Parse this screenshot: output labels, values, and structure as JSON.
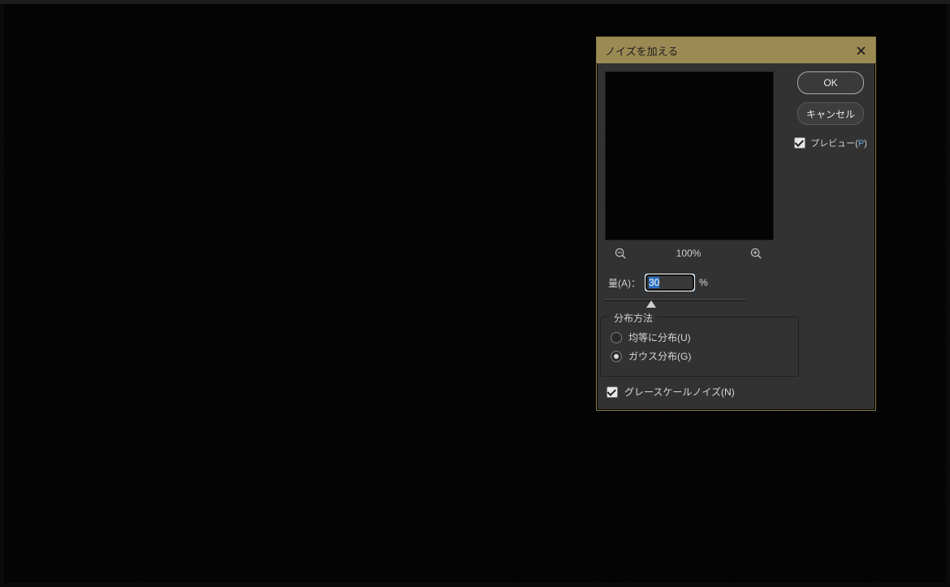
{
  "dialog": {
    "title": "ノイズを加える",
    "ok": "OK",
    "cancel": "キャンセル",
    "preview_label_prefix": "プレビュー(",
    "preview_hotkey": "P",
    "preview_label_suffix": ")",
    "preview_checked": true,
    "zoom_pct": "100%",
    "amount_label": "量(A)：",
    "amount_value": "30",
    "amount_unit": "%",
    "distribution_group": "分布方法",
    "dist_uniform": "均等に分布(U)",
    "dist_gaussian": "ガウス分布(G)",
    "dist_selected": "gaussian",
    "monochrome": "グレースケールノイズ(N)",
    "monochrome_checked": true
  }
}
